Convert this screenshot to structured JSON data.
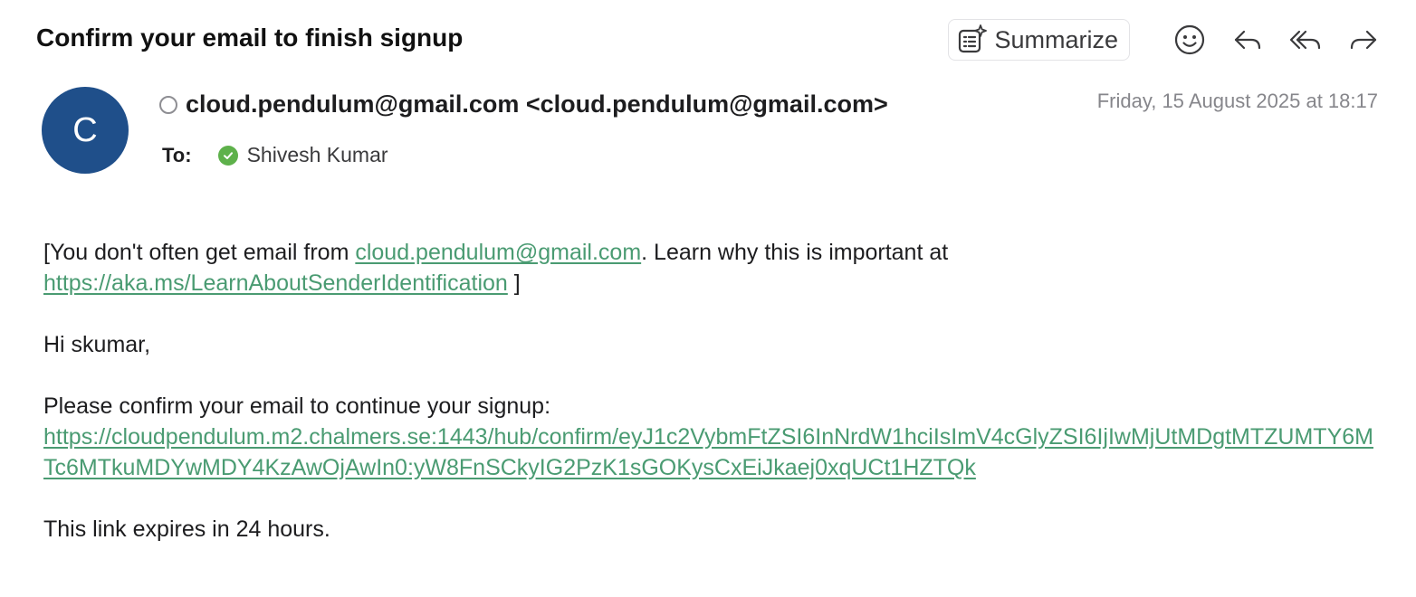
{
  "subject": "Confirm your email to finish signup",
  "toolbar": {
    "summarize_label": "Summarize",
    "icons": [
      "summarize-icon",
      "emoji-icon",
      "reply-icon",
      "reply-all-icon",
      "forward-icon"
    ]
  },
  "sender": {
    "avatar_letter": "C",
    "display": "cloud.pendulum@gmail.com <cloud.pendulum@gmail.com>",
    "date": "Friday, 15 August 2025 at 18:17"
  },
  "recipients": {
    "label": "To:",
    "name": "Shivesh Kumar"
  },
  "body": {
    "notice_pre": "[You don't often get email from ",
    "notice_email": "cloud.pendulum@gmail.com",
    "notice_mid": ". Learn why this is important at ",
    "notice_link": "https://aka.ms/LearnAboutSenderIdentification",
    "notice_post": " ]",
    "greeting": "Hi skumar,",
    "instruction": "Please confirm your email to continue your signup:",
    "confirm_link": "https://cloudpendulum.m2.chalmers.se:1443/hub/confirm/eyJ1c2VybmFtZSI6InNrdW1hciIsImV4cGlyZSI6IjIwMjUtMDgtMTZUMTY6MTc6MTkuMDYwMDY4KzAwOjAwIn0:yW8FnSCkyIG2PzK1sGOKysCxEiJkaej0xqUCt1HZTQk",
    "expiry": "This link expires in 24 hours."
  },
  "colors": {
    "avatar": "#1f4f8a",
    "link": "#4a9b72",
    "verified": "#5eb14b"
  }
}
